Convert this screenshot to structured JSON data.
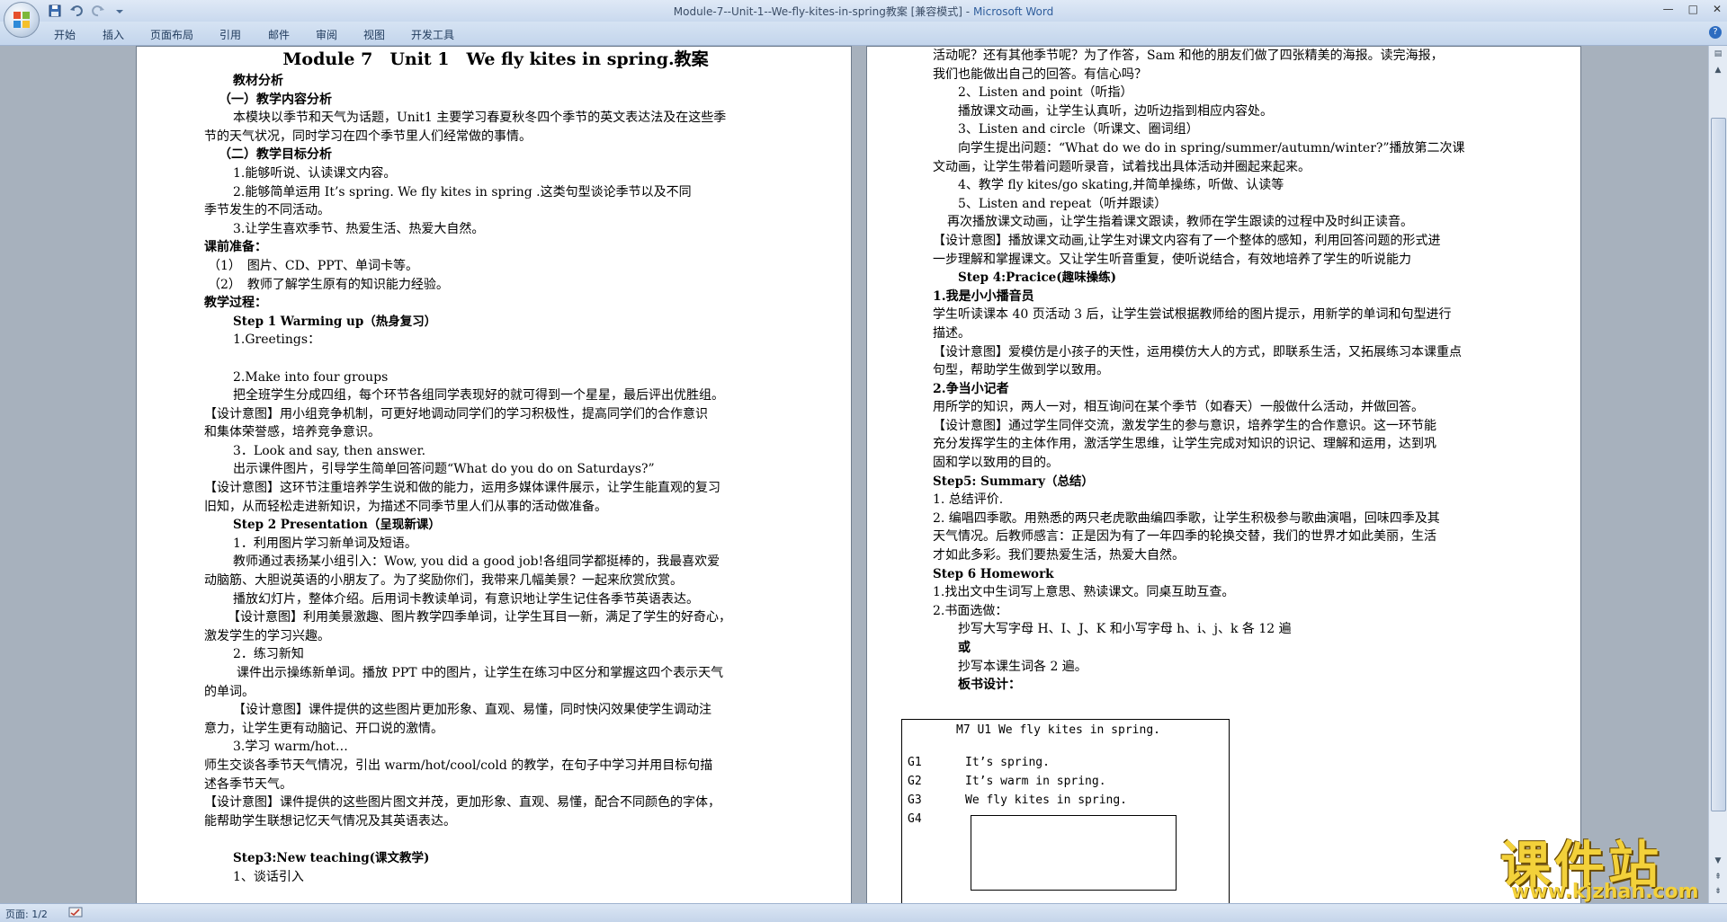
{
  "window": {
    "title": "Module-7--Unit-1--We-fly-kites-in-spring教案 [兼容模式] - ",
    "app_name": "Microsoft Word",
    "minimize": "—",
    "maximize": "□",
    "close": "✕"
  },
  "ribbon": {
    "tabs": [
      "开始",
      "插入",
      "页面布局",
      "引用",
      "邮件",
      "审阅",
      "视图",
      "开发工具"
    ],
    "help": "?"
  },
  "page1": {
    "lines": [
      "Module 7　Unit 1　We fly kites in spring.教案",
      "教材分析",
      "（一）教学内容分析",
      "本模块以季节和天气为话题，Unit1 主要学习春夏秋冬四个季节的英文表达法及在这些季",
      "节的天气状况，同时学习在四个季节里人们经常做的事情。",
      "（二）教学目标分析",
      "1.能够听说、认读课文内容。",
      "2.能够简单运用 It’s spring. We fly kites in spring .这类句型谈论季节以及不同",
      "季节发生的不同活动。",
      "3.让学生喜欢季节、热爱生活、热爱大自然。",
      "课前准备：",
      "（1）　图片、CD、PPT、单词卡等。",
      "（2）　教师了解学生原有的知识能力经验。",
      "教学过程：",
      "Step 1 Warming up（热身复习）",
      "1.Greetings：",
      "",
      "2.Make into four groups",
      "把全班学生分成四组，每个环节各组同学表现好的就可得到一个星星，最后评出优胜组。",
      "【设计意图】用小组竞争机制，可更好地调动同学们的学习积极性，提高同学们的合作意识",
      "和集体荣誉感，培养竞争意识。",
      "3．Look and say, then answer.",
      "出示课件图片，引导学生简单回答问题“What do you do on Saturdays?”",
      "【设计意图】这环节注重培养学生说和做的能力，运用多媒体课件展示，让学生能直观的复习",
      "旧知，从而轻松走进新知识，为描述不同季节里人们从事的活动做准备。",
      "Step 2 Presentation（呈现新课）",
      "1．利用图片学习新单词及短语。",
      "教师通过表扬某小组引入：Wow, you did a good job!各组同学都挺棒的，我最喜欢爱",
      "动脑筋、大胆说英语的小朋友了。为了奖励你们，我带来几幅美景？一起来欣赏欣赏。",
      "播放幻灯片，整体介绍。后用词卡教读单词，有意识地让学生记住各季节英语表达。",
      "【设计意图】利用美景激趣、图片教学四季单词，让学生耳目一新，满足了学生的好奇心，",
      "激发学生的学习兴趣。",
      "2．练习新知",
      "课件出示操练新单词。播放 PPT 中的图片，让学生在练习中区分和掌握这四个表示天气",
      "的单词。",
      "【设计意图】课件提供的这些图片更加形象、直观、易懂，同时快闪效果使学生调动注",
      "意力，让学生更有动脑记、开口说的激情。",
      "3.学习 warm/hot…",
      "师生交谈各季节天气情况，引出 warm/hot/cool/cold 的教学，在句子中学习并用目标句描",
      "述各季节天气。",
      "【设计意图】课件提供的这些图片图文并茂，更加形象、直观、易懂，配合不同颜色的字体，",
      "能帮助学生联想记忆天气情况及其英语表达。",
      "",
      "Step3:New teaching(课文教学)",
      "1、谈话引入"
    ]
  },
  "page2": {
    "lines": [
      "活动呢？还有其他季节呢？为了作答，Sam 和他的朋友们做了四张精美的海报。读完海报，",
      "我们也能做出自己的回答。有信心吗？",
      "2、Listen and point（听指）",
      "播放课文动画，让学生认真听，边听边指到相应内容处。",
      "3、Listen and circle（听课文、圈词组）",
      "向学生提出问题：“What do we do in spring/summer/autumn/winter?”播放第二次课",
      "文动画，让学生带着问题听录音，试着找出具体活动并圈起来起来。",
      "4、教学 fly kites/go skating,并简单操练，听做、认读等",
      "5、Listen and repeat（听并跟读）",
      "再次播放课文动画，让学生指着课文跟读，教师在学生跟读的过程中及时纠正读音。",
      "【设计意图】播放课文动画,让学生对课文内容有了一个整体的感知，利用回答问题的形式进",
      "一步理解和掌握课文。又让学生听音重复，使听说结合，有效地培养了学生的听说能力",
      "Step 4:Pracice(趣味操练)",
      "1.我是小小播音员",
      "学生听读课本 40 页活动 3 后，让学生尝试根据教师给的图片提示，用新学的单词和句型进行",
      "描述。",
      "【设计意图】爱模仿是小孩子的天性，运用模仿大人的方式，即联系生活，又拓展练习本课重点",
      "句型，帮助学生做到学以致用。",
      "2.争当小记者",
      "用所学的知识，两人一对，相互询问在某个季节（如春天）一般做什么活动，并做回答。",
      "【设计意图】通过学生同伴交流，激发学生的参与意识，培养学生的合作意识。这一环节能",
      "充分发挥学生的主体作用，激活学生思维，让学生完成对知识的识记、理解和运用，达到巩",
      "固和学以致用的目的。",
      "Step5: Summary（总结）",
      "1. 总结评价.",
      "2. 编唱四季歌。用熟悉的两只老虎歌曲编四季歌，让学生积极参与歌曲演唱，回味四季及其",
      "天气情况。后教师感言：正是因为有了一年四季的轮换交替，我们的世界才如此美丽，生活",
      "才如此多彩。我们要热爱生活，热爱大自然。",
      "Step 6 Homework",
      "1.找出文中生词写上意思、熟读课文。同桌互助互查。",
      "2.书面选做：",
      "抄写大写字母 H、I、J、K 和小写字母 h、i、j、k 各 12 遍",
      "或",
      "抄写本课生词各 2 遍。",
      "板书设计：",
      ""
    ],
    "board": {
      "title": "M7 U1 We fly kites in spring.",
      "rows": [
        {
          "label": "G1",
          "text": "It’s spring."
        },
        {
          "label": "G2",
          "text": "It’s warm in spring."
        },
        {
          "label": "G3",
          "text": "We fly kites in spring."
        },
        {
          "label": "G4",
          "text": ""
        }
      ]
    }
  },
  "statusbar": {
    "page_info": "页面: 1/2"
  },
  "watermark": {
    "name": "课件站",
    "url": "www.kjzhan.com"
  },
  "colors": {
    "titlebar": "#dfe9f6",
    "app_name": "#2f5d9c",
    "doc_background": "#a7b1bd",
    "watermark": "#f3d13a"
  }
}
